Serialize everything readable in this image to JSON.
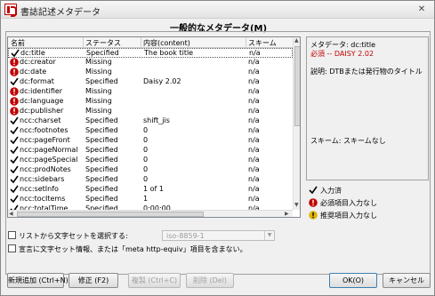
{
  "window": {
    "title": "書誌記述メタデータ"
  },
  "section_title": "一般的なメタデータ(M)",
  "table": {
    "headers": [
      "名前",
      "ステータス",
      "内容(content)",
      "スキーム"
    ],
    "rows": [
      {
        "icon": "check",
        "name": "dc:title",
        "status": "Specified",
        "content": "The book title",
        "scheme": "n/a"
      },
      {
        "icon": "required",
        "name": "dc:creator",
        "status": "Missing",
        "content": "",
        "scheme": "n/a"
      },
      {
        "icon": "required",
        "name": "dc:date",
        "status": "Missing",
        "content": "",
        "scheme": "n/a"
      },
      {
        "icon": "check",
        "name": "dc:format",
        "status": "Specified",
        "content": "Daisy 2.02",
        "scheme": "n/a"
      },
      {
        "icon": "required",
        "name": "dc:identifier",
        "status": "Missing",
        "content": "",
        "scheme": "n/a"
      },
      {
        "icon": "required",
        "name": "dc:language",
        "status": "Missing",
        "content": "",
        "scheme": "n/a"
      },
      {
        "icon": "required",
        "name": "dc:publisher",
        "status": "Missing",
        "content": "",
        "scheme": "n/a"
      },
      {
        "icon": "check",
        "name": "ncc:charset",
        "status": "Specified",
        "content": "shift_jis",
        "scheme": "n/a"
      },
      {
        "icon": "check",
        "name": "ncc:footnotes",
        "status": "Specified",
        "content": "0",
        "scheme": "n/a"
      },
      {
        "icon": "check",
        "name": "ncc:pageFront",
        "status": "Specified",
        "content": "0",
        "scheme": "n/a"
      },
      {
        "icon": "check",
        "name": "ncc:pageNormal",
        "status": "Specified",
        "content": "0",
        "scheme": "n/a"
      },
      {
        "icon": "check",
        "name": "ncc:pageSpecial",
        "status": "Specified",
        "content": "0",
        "scheme": "n/a"
      },
      {
        "icon": "check",
        "name": "ncc:prodNotes",
        "status": "Specified",
        "content": "0",
        "scheme": "n/a"
      },
      {
        "icon": "check",
        "name": "ncc:sidebars",
        "status": "Specified",
        "content": "0",
        "scheme": "n/a"
      },
      {
        "icon": "check",
        "name": "ncc:setInfo",
        "status": "Specified",
        "content": "1 of 1",
        "scheme": "n/a"
      },
      {
        "icon": "check",
        "name": "ncc:tocItems",
        "status": "Specified",
        "content": "1",
        "scheme": "n/a"
      },
      {
        "icon": "check",
        "name": "ncc:totalTime",
        "status": "Specified",
        "content": "0:00:00",
        "scheme": "n/a"
      }
    ]
  },
  "detail": {
    "metadata_label": "メタデータ: dc:title",
    "status_line": "必須 -- DAISY 2.02",
    "description": "説明: DTBまたは発行物のタイトル",
    "scheme": "スキーム: スキームなし"
  },
  "legend": [
    {
      "icon": "check",
      "label": "入力済"
    },
    {
      "icon": "required",
      "label": "必須項目入力なし"
    },
    {
      "icon": "recommended",
      "label": "推奨項目入力なし"
    }
  ],
  "options": {
    "charset_checkbox_label": "リストから文字セットを選択する:",
    "charset_select_value": "iso-8859-1",
    "exclude_checkbox_label": "宣言に文字セット情報、または「meta http-equiv」項目を含まない。"
  },
  "buttons": {
    "add": "新規追加 (Ctrl+N)",
    "edit": "修正 (F2)",
    "copy": "複製 (Ctrl+C)",
    "delete": "削除 (Del)",
    "ok": "OK(O)",
    "cancel": "キャンセル"
  },
  "colors": {
    "required_icon": "#c00000",
    "recommended_icon": "#e0b400",
    "selection_border": "#555555",
    "accent_text": "#c00000"
  }
}
